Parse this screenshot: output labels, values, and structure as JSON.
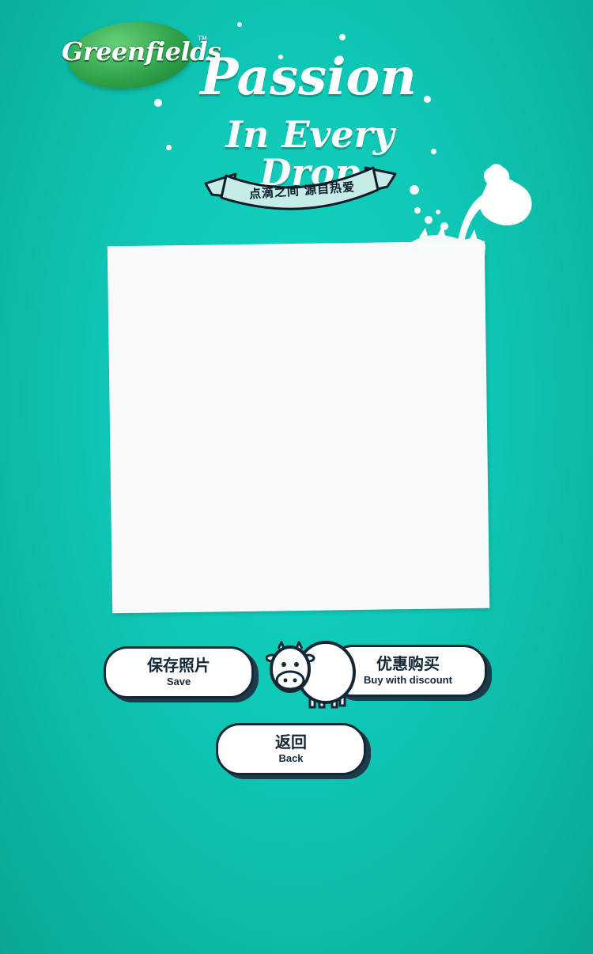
{
  "brand": {
    "logo_text": "Greenfields",
    "trademark": "TM"
  },
  "headline": {
    "line1": "Passion",
    "line2": "In Every Drop"
  },
  "ribbon": {
    "text": "点滴之间 源自热爱"
  },
  "actions": {
    "save": {
      "label_cn": "保存照片",
      "label_en": "Save"
    },
    "buy": {
      "label_cn": "优惠购买",
      "label_en": "Buy with discount"
    },
    "back": {
      "label_cn": "返回",
      "label_en": "Back"
    }
  },
  "colors": {
    "background": "#0fc6b4",
    "button_border": "#142736",
    "button_shadow": "#1b3a4a",
    "ribbon_fill": "#c6ece8"
  },
  "icons": {
    "mascot": "cow-icon",
    "decoration": "milk-pitcher-icon"
  }
}
